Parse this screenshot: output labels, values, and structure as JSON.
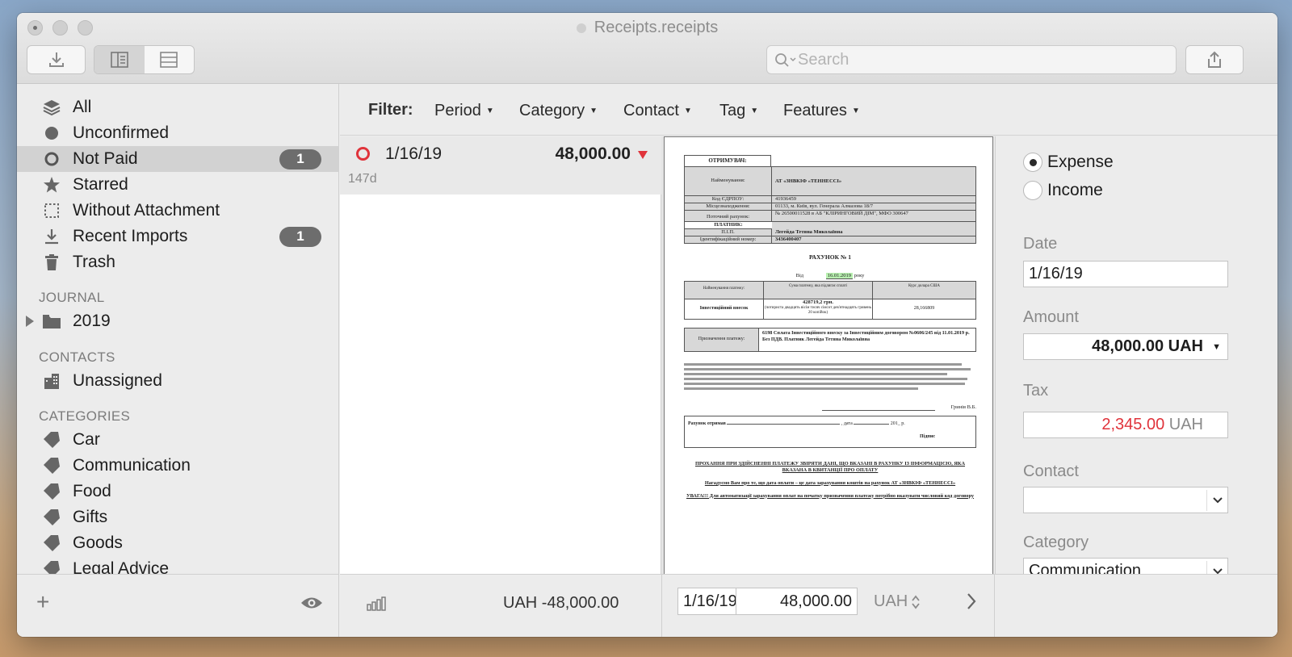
{
  "window": {
    "title": "Receipts.receipts"
  },
  "toolbar": {
    "search_placeholder": "Search"
  },
  "sidebar": {
    "items": [
      {
        "label": "All",
        "icon": "layers-icon"
      },
      {
        "label": "Unconfirmed",
        "icon": "filled-circle-icon"
      },
      {
        "label": "Not Paid",
        "icon": "ring-icon",
        "badge": "1",
        "selected": true
      },
      {
        "label": "Starred",
        "icon": "star-icon"
      },
      {
        "label": "Without Attachment",
        "icon": "dotted-square-icon"
      },
      {
        "label": "Recent Imports",
        "icon": "download-icon",
        "badge": "1"
      },
      {
        "label": "Trash",
        "icon": "trash-icon"
      }
    ],
    "journal_heading": "JOURNAL",
    "journal_items": [
      {
        "label": "2019",
        "icon": "folder-icon"
      }
    ],
    "contacts_heading": "CONTACTS",
    "contacts_items": [
      {
        "label": "Unassigned",
        "icon": "building-icon"
      }
    ],
    "categories_heading": "CATEGORIES",
    "categories": [
      "Car",
      "Communication",
      "Food",
      "Gifts",
      "Goods",
      "Legal Advice"
    ]
  },
  "filter": {
    "label": "Filter:",
    "items": [
      "Period",
      "Category",
      "Contact",
      "Tag",
      "Features"
    ]
  },
  "list": {
    "rows": [
      {
        "date": "1/16/19",
        "amount": "48,000.00",
        "age": "147d",
        "status_color": "#e0333b"
      }
    ]
  },
  "document": {
    "recipient_header": "ОТРИМУВАЧ:",
    "name_label": "Найменування:",
    "name_value": "АТ «ЗНВКІФ «ТЕННЕССІ»",
    "edrpou_label": "Код ЄДРПОУ:",
    "edrpou_value": "41936459",
    "location_label": "Місцезнаходження:",
    "location_value": "01133, м. Київ, вул. Генерала Алмазова 18/7",
    "account_label": "Поточний рахунок:",
    "account_value": "№ 26500011528 в АБ \"КЛІРИНГОВИЙ ДІМ\", МФО 300647",
    "payer_header": "ПЛАТНИК:",
    "pib_label": "П.І.П.",
    "pib_value": "Легейда Тетяна Миколаївна",
    "id_label": "Ідентифікаційний номер:",
    "id_value": "3436400407",
    "invoice_title": "РАХУНОК № 1",
    "date_prefix": "Від",
    "date_value": "16.01.2019",
    "date_suffix": "року",
    "tbl_col1": "Найменування платежу:",
    "tbl_col2": "Сума платежу, яка підлягає сплаті",
    "tbl_col3": "Курс долара США",
    "tbl_row_label": "Інвестиційний внесок",
    "tbl_sum": "428719,2 грн.",
    "tbl_sum_words": "(чотириста двадцять вісім тисяч сімсот дев'ятнадцять гривень 20 копійок)",
    "tbl_rate": "28,166809",
    "purpose_label": "Призначення платежу:",
    "purpose_value": "6198 Сплата Інвестиційного внеску за Інвестиційним договором №0606/245 від 11.01.2019 р. Без ПДВ. Платник Легейда Тетяна Миколаївна",
    "signature_name": "Гринів В.Б.",
    "received_label": "Рахунок отримав",
    "received_date": ", дата",
    "received_year": "201_ р.",
    "sign_label": "Підпис",
    "notice1": "ПРОХАННЯ ПРИ ЗДІЙСНЕННІ ПЛАТЕЖУ ЗВІРЯТИ ДАНІ, ЩО ВКАЗАНІ В РАХУНКУ ІЗ ІНФОРМАЦІЄЮ, ЯКА ВКАЗАНА В КВИТАНЦІЇ ПРО ОПЛАТУ",
    "notice2": "Нагадуємо Вам про те, що дата оплати – це дата зарахування коштів на рахунок АТ «ЗНВКІФ «ТЕННЕССІ»",
    "notice3": "УВАГА!!! Для автоматизації зарахування оплат на початку призначення платежу потрібно вказувати числовий код договору"
  },
  "details": {
    "type_expense": "Expense",
    "type_income": "Income",
    "date_label": "Date",
    "date_value": "1/16/19",
    "amount_label": "Amount",
    "amount_value": "48,000.00 UAH",
    "tax_label": "Tax",
    "tax_value": "2,345.00",
    "tax_currency": "UAH",
    "tax_color": "#e0333b",
    "contact_label": "Contact",
    "contact_value": "",
    "category_label": "Category",
    "category_value": "Communication"
  },
  "bottombar": {
    "total": "UAH -48,000.00",
    "entry_date": "1/16/19",
    "entry_amount": "48,000.00",
    "entry_currency": "UAH"
  }
}
